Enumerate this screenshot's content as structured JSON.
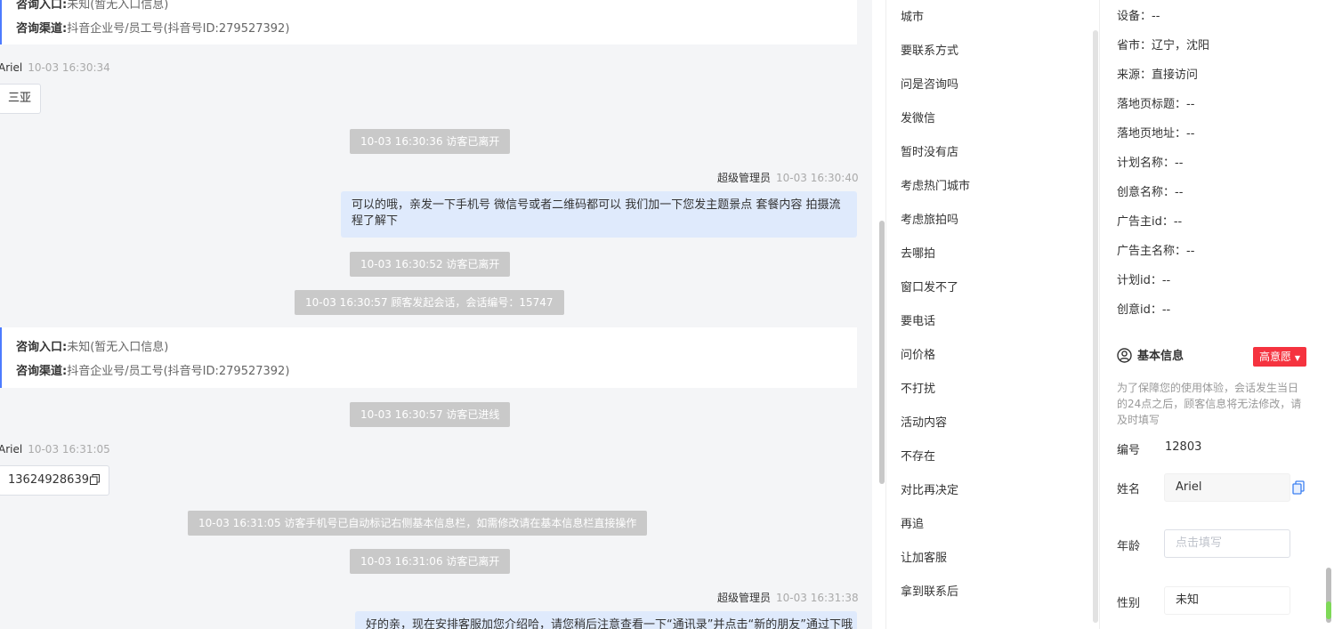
{
  "chat": {
    "card1": {
      "entry_label": "咨询入口:",
      "entry_value": "未知(暂无入口信息)",
      "channel_label": "咨询渠道:",
      "channel_value": "抖音企业号/员工号(抖音号ID:279527392)"
    },
    "msg1": {
      "sender": "Ariel",
      "time": "10-03 16:30:34",
      "text": "三亚"
    },
    "sys1": "10-03 16:30:36 访客已离开",
    "msg2": {
      "sender": "超级管理员",
      "time": "10-03 16:30:40",
      "text": "可以的哦，亲发一下手机号 微信号或者二维码都可以 我们加一下您发主题景点 套餐内容 拍摄流程了解下"
    },
    "sys2": "10-03 16:30:52 访客已离开",
    "sys3": "10-03 16:30:57 顾客发起会话，会话编号：15747",
    "card2": {
      "entry_label": "咨询入口:",
      "entry_value": "未知(暂无入口信息)",
      "channel_label": "咨询渠道:",
      "channel_value": "抖音企业号/员工号(抖音号ID:279527392)"
    },
    "sys4": "10-03 16:30:57 访客已进线",
    "msg3": {
      "sender": "Ariel",
      "time": "10-03 16:31:05",
      "text": "13624928639"
    },
    "sys5": "10-03 16:31:05 访客手机号已自动标记右侧基本信息栏，如需修改请在基本信息栏直接操作",
    "sys6": "10-03 16:31:06 访客已离开",
    "msg4": {
      "sender": "超级管理员",
      "time": "10-03 16:31:38",
      "text": "好的亲，现在安排客服加您介绍哈，请您稍后注意查看一下“通讯录”并点击“新的朋友”通过下哦"
    }
  },
  "quick_replies": [
    "城市",
    "要联系方式",
    "问是咨询吗",
    "发微信",
    "暂时没有店",
    "考虑热门城市",
    "考虑旅拍吗",
    "去哪拍",
    "窗口发不了",
    "要电话",
    "问价格",
    "不打扰",
    "活动内容",
    "不存在",
    "对比再决定",
    "再追",
    "让加客服",
    "拿到联系后"
  ],
  "visitor": {
    "rows": [
      "设备：--",
      "省市：辽宁，沈阳",
      "来源：直接访问",
      "落地页标题：--",
      "落地页地址：--",
      "计划名称：--",
      "创意名称：--",
      "广告主id：--",
      "广告主名称：--",
      "计划id：--",
      "创意id：--"
    ],
    "section_title": "基本信息",
    "intent_badge": "高意愿",
    "notice": "为了保障您的使用体验，会话发生当日的24点之后，顾客信息将无法修改，请及时填写",
    "id_label": "编号",
    "id_value": "12803",
    "name_label": "姓名",
    "name_value": "Ariel",
    "age_label": "年龄",
    "age_placeholder": "点击填写",
    "gender_label": "性别",
    "gender_value": "未知"
  },
  "colors": {
    "accent": "#4c7bff",
    "badge": "#f5333f",
    "bubble_right": "#dfeafc",
    "system_msg": "#c9c9c9"
  }
}
